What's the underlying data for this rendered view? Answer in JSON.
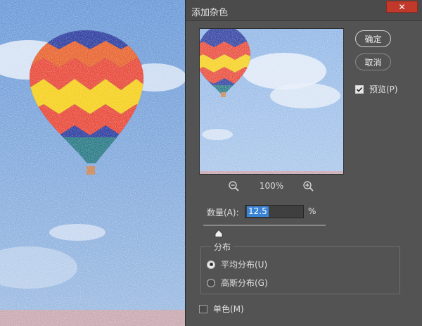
{
  "dialog": {
    "title": "添加杂色",
    "close_glyph": "✕",
    "ok_label": "确定",
    "cancel_label": "取消",
    "preview_label": "预览(P)",
    "preview_checked": true,
    "zoom_level": "100%",
    "zoom_out_icon": "zoom-out-icon",
    "zoom_in_icon": "zoom-in-icon",
    "amount_label": "数量(A):",
    "amount_value": "12.5",
    "amount_unit": "%",
    "amount_slider_fraction": 0.125,
    "distribution": {
      "legend": "分布",
      "options": [
        {
          "label": "平均分布(U)",
          "selected": true
        },
        {
          "label": "高斯分布(G)",
          "selected": false
        }
      ]
    },
    "monochromatic_label": "单色(M)",
    "monochromatic_checked": false
  },
  "colors": {
    "dialog_bg": "#535353",
    "close_button": "#c0392b",
    "selection_highlight": "#3a84d6",
    "sky_blue": "#6b97cf"
  }
}
